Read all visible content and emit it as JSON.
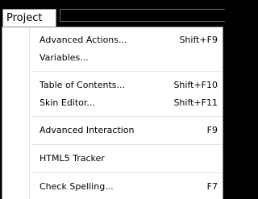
{
  "menubar": {
    "active_menu": "Project"
  },
  "menu": {
    "items": [
      {
        "label": "Advanced Actions...",
        "shortcut": "Shift+F9"
      },
      {
        "label": "Variables...",
        "shortcut": ""
      },
      {
        "label": "Table of Contents...",
        "shortcut": "Shift+F10"
      },
      {
        "label": "Skin Editor...",
        "shortcut": "Shift+F11"
      },
      {
        "label": "Advanced Interaction",
        "shortcut": "F9"
      },
      {
        "label": "HTML5 Tracker",
        "shortcut": ""
      },
      {
        "label": "Check Spelling...",
        "shortcut": "F7"
      }
    ]
  }
}
